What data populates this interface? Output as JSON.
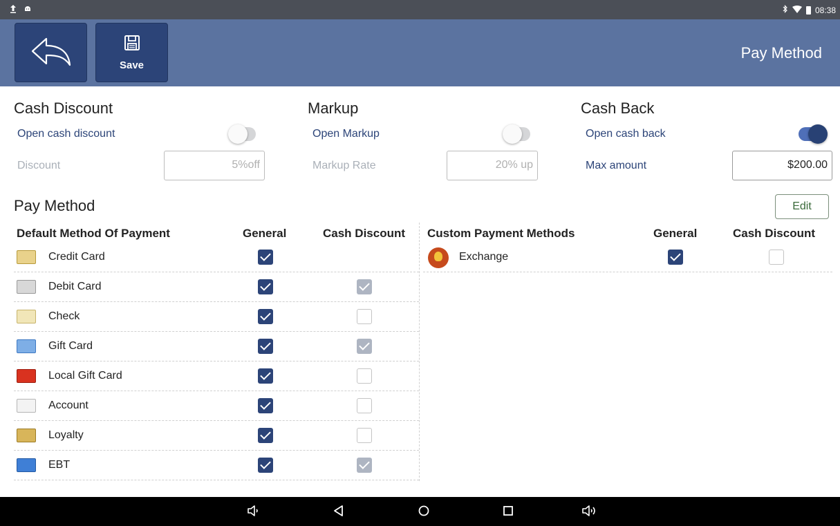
{
  "status_bar": {
    "left_icons": [
      "upload-icon",
      "android-icon"
    ],
    "right_icons": [
      "bluetooth-icon",
      "wifi-icon",
      "battery-icon"
    ],
    "time": "08:38"
  },
  "app_bar": {
    "back_icon": "back-arrow-icon",
    "save_icon": "floppy-disk-icon",
    "save_label": "Save",
    "title": "Pay Method"
  },
  "cash_discount": {
    "title": "Cash Discount",
    "toggle_label": "Open cash discount",
    "enabled": false,
    "field_label": "Discount",
    "field_value": "5%off"
  },
  "markup": {
    "title": "Markup",
    "toggle_label": "Open Markup",
    "enabled": false,
    "field_label": "Markup Rate",
    "field_value": "20% up"
  },
  "cash_back": {
    "title": "Cash Back",
    "toggle_label": "Open cash back",
    "enabled": true,
    "field_label": "Max amount",
    "field_value": "$200.00"
  },
  "pay_method": {
    "title": "Pay Method",
    "edit_label": "Edit",
    "default_table": {
      "headers": [
        "Default Method Of Payment",
        "General",
        "Cash Discount"
      ],
      "rows": [
        {
          "name": "Credit Card",
          "icon": "credit-card-icon",
          "general": true,
          "cash_discount": null
        },
        {
          "name": "Debit Card",
          "icon": "debit-card-icon",
          "general": true,
          "cash_discount": "disabled-checked"
        },
        {
          "name": "Check",
          "icon": "check-icon",
          "general": true,
          "cash_discount": false
        },
        {
          "name": "Gift Card",
          "icon": "gift-card-icon",
          "general": true,
          "cash_discount": "disabled-checked"
        },
        {
          "name": "Local Gift Card",
          "icon": "local-gift-card-icon",
          "general": true,
          "cash_discount": false
        },
        {
          "name": "Account",
          "icon": "account-icon",
          "general": true,
          "cash_discount": false
        },
        {
          "name": "Loyalty",
          "icon": "loyalty-icon",
          "general": true,
          "cash_discount": false
        },
        {
          "name": "EBT",
          "icon": "ebt-icon",
          "general": true,
          "cash_discount": "disabled-checked"
        }
      ]
    },
    "custom_table": {
      "headers": [
        "Custom Payment Methods",
        "General",
        "Cash Discount"
      ],
      "rows": [
        {
          "name": "Exchange",
          "icon": "lightbulb-icon",
          "general": true,
          "cash_discount": false
        }
      ]
    }
  },
  "nav_bar": {
    "buttons": [
      "volume-down-icon",
      "back-icon",
      "home-icon",
      "recents-icon",
      "volume-up-icon"
    ]
  },
  "colors": {
    "app_bar": "#5b73a0",
    "button_dark": "#2c4478",
    "accent": "#2c4478"
  }
}
